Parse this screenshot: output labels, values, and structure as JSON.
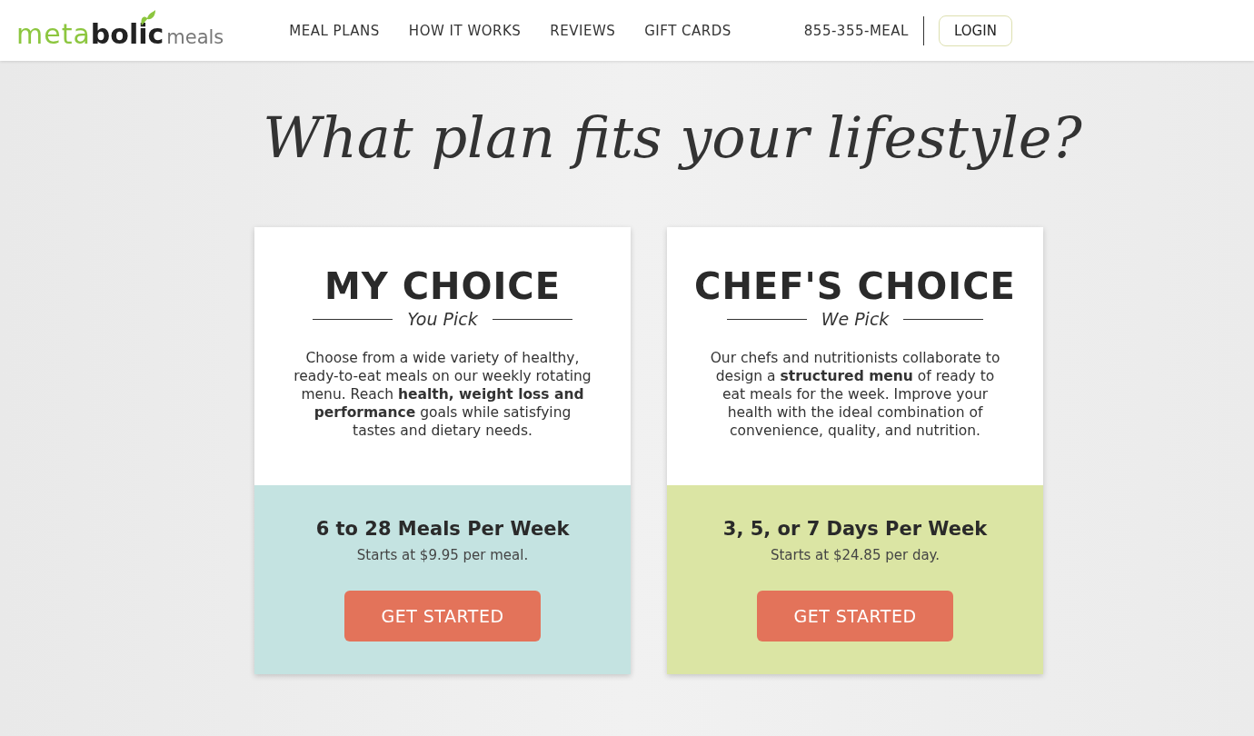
{
  "logo": {
    "light": "meta",
    "bold": "bolic",
    "small": "meals"
  },
  "nav": [
    "MEAL PLANS",
    "HOW IT WORKS",
    "REVIEWS",
    "GIFT CARDS"
  ],
  "phone": "855-355-MEAL",
  "login": "LOGIN",
  "headline": "What plan fits your lifestyle?",
  "plans": [
    {
      "title": "MY CHOICE",
      "subtitle": "You Pick",
      "description": "Choose from a wide variety of healthy, ready-to-eat meals on our weekly rotating menu. Reach **health, weight loss and performance** goals while satisfying tastes and dietary needs.",
      "offer": "6 to 28 Meals Per Week",
      "price": "Starts at $9.95 per meal.",
      "button": "GET STARTED",
      "color": "#c4e3e1"
    },
    {
      "title": "CHEF'S CHOICE",
      "subtitle": "We Pick",
      "description": "Our chefs and nutritionists collaborate to design a **structured menu** of ready to eat meals for the week. Improve your health with the ideal combination of convenience, quality, and nutrition.",
      "offer": "3, 5, or 7 Days Per Week",
      "price": "Starts at $24.85 per day.",
      "button": "GET STARTED",
      "color": "#dbe5a4"
    }
  ]
}
